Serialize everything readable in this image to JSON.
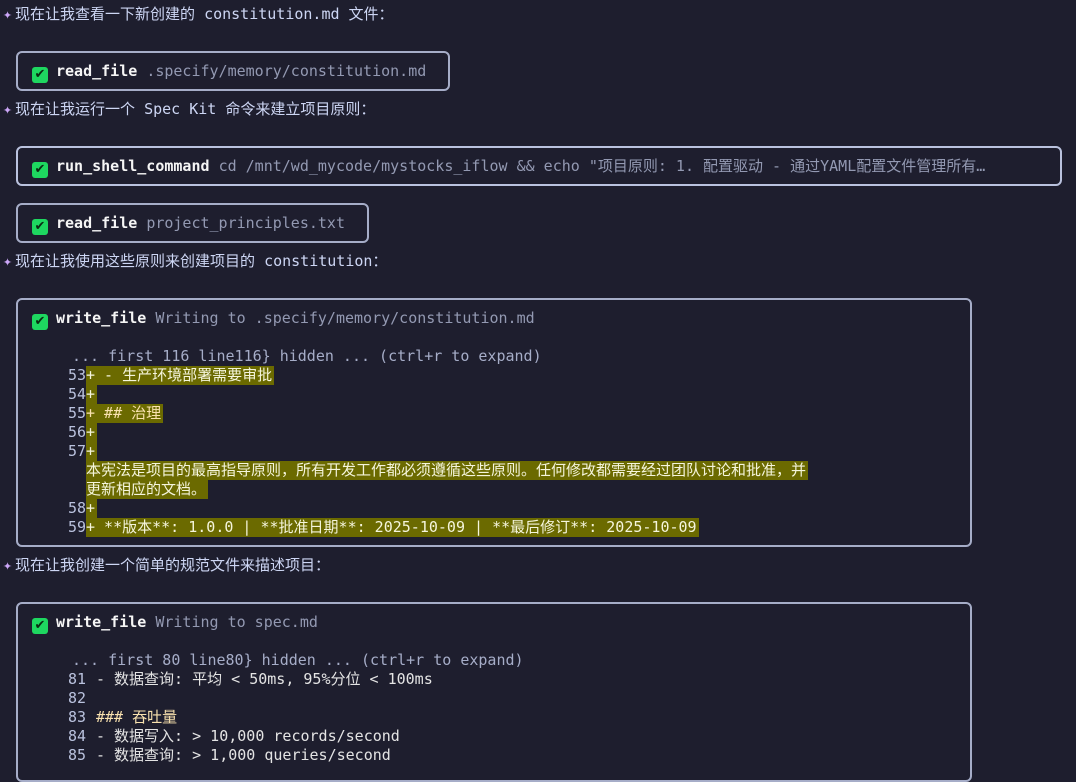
{
  "messages": [
    "现在让我查看一下新创建的 constitution.md 文件：",
    "现在让我运行一个 Spec Kit 命令来建立项目原则：",
    "现在让我使用这些原则来创建项目的 constitution：",
    "现在让我创建一个简单的规范文件来描述项目："
  ],
  "star_glyph": "✦",
  "check_glyph": "✔",
  "tool_calls": [
    {
      "name": "read_file",
      "arg": ".specify/memory/constitution.md"
    },
    {
      "name": "run_shell_command",
      "arg": "cd /mnt/wd_mycode/mystocks_iflow && echo \"项目原则: 1. 配置驱动 - 通过YAML配置文件管理所有…"
    },
    {
      "name": "read_file",
      "arg": "project_principles.txt"
    },
    {
      "name": "write_file",
      "arg": "Writing to .specify/memory/constitution.md"
    },
    {
      "name": "write_file",
      "arg": "Writing to spec.md"
    }
  ],
  "diff1": {
    "hidden_note": "... first 116 line116} hidden ... (ctrl+r to expand)",
    "lines": [
      {
        "no": "53",
        "text": "+ - 生产环境部署需要审批"
      },
      {
        "no": "54",
        "text": "+"
      },
      {
        "no": "55",
        "text": "+ ## 治理"
      },
      {
        "no": "56",
        "text": "+"
      },
      {
        "no": "57",
        "text": "+"
      },
      {
        "no": "",
        "text": "本宪法是项目的最高指导原则，所有开发工作都必须遵循这些原则。任何修改都需要经过团队讨论和批准，并"
      },
      {
        "no": "",
        "text": "更新相应的文档。"
      },
      {
        "no": "58",
        "text": "+"
      },
      {
        "no": "59",
        "text": "+ **版本**: 1.0.0 | **批准日期**: 2025-10-09 | **最后修订**: 2025-10-09"
      }
    ]
  },
  "diff2": {
    "hidden_note": "... first 80 line80} hidden ... (ctrl+r to expand)",
    "lines": [
      {
        "no": "81",
        "text": "- 数据查询: 平均 < 50ms, 95%分位 < 100ms"
      },
      {
        "no": "82",
        "text": ""
      },
      {
        "no": "83",
        "text": "### 吞吐量"
      },
      {
        "no": "84",
        "text": "- 数据写入: > 10,000 records/second"
      },
      {
        "no": "85",
        "text": "- 数据查询: > 1,000 queries/second"
      }
    ]
  }
}
